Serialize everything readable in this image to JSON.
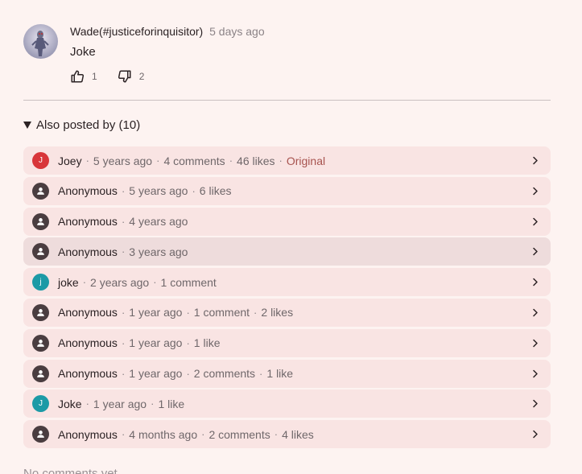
{
  "comment": {
    "author": "Wade(#justiceforinquisitor)",
    "time": "5 days ago",
    "text": "Joke",
    "likes": "1",
    "dislikes": "2"
  },
  "also_posted": {
    "header": "Also posted by (10)",
    "items": [
      {
        "name": "Joey",
        "initial": "J",
        "avatar_color": "#d8363a",
        "anonymous": false,
        "meta": [
          "5 years ago",
          "4 comments",
          "46 likes"
        ],
        "original": "Original"
      },
      {
        "name": "Anonymous",
        "anonymous": true,
        "meta": [
          "5 years ago",
          "6 likes"
        ]
      },
      {
        "name": "Anonymous",
        "anonymous": true,
        "meta": [
          "4 years ago"
        ]
      },
      {
        "name": "Anonymous",
        "anonymous": true,
        "meta": [
          "3 years ago"
        ],
        "hover": true
      },
      {
        "name": "joke",
        "initial": "j",
        "avatar_color": "#1c9aa6",
        "anonymous": false,
        "meta": [
          "2 years ago",
          "1 comment"
        ]
      },
      {
        "name": "Anonymous",
        "anonymous": true,
        "meta": [
          "1 year ago",
          "1 comment",
          "2 likes"
        ]
      },
      {
        "name": "Anonymous",
        "anonymous": true,
        "meta": [
          "1 year ago",
          "1 like"
        ]
      },
      {
        "name": "Anonymous",
        "anonymous": true,
        "meta": [
          "1 year ago",
          "2 comments",
          "1 like"
        ]
      },
      {
        "name": "Joke",
        "initial": "J",
        "avatar_color": "#1c9aa6",
        "anonymous": false,
        "meta": [
          "1 year ago",
          "1 like"
        ]
      },
      {
        "name": "Anonymous",
        "anonymous": true,
        "meta": [
          "4 months ago",
          "2 comments",
          "4 likes"
        ]
      }
    ]
  },
  "footer": {
    "no_comments": "No comments yet"
  },
  "colors": {
    "background": "#fdf3f1",
    "row_background": "#f9e4e3",
    "row_hover": "#eedcdc",
    "original_accent": "#a7534f"
  },
  "icons": {
    "like": "thumbs-up-icon",
    "dislike": "thumbs-down-icon",
    "anonymous": "person-icon",
    "row_action": "chevron-right-icon",
    "expand": "triangle-down-icon"
  }
}
